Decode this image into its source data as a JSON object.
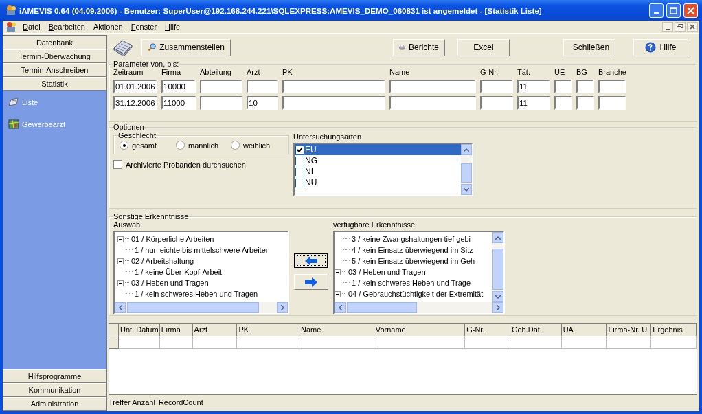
{
  "window": {
    "title": "iAMEVIS 0.64 (04.09.2006) - Benutzer: SuperUser@192.168.244.221\\SQLEXPRESS:AMEVIS_DEMO_060831 ist angemeldet  - [Statistik Liste]"
  },
  "menu": [
    {
      "label": "Datei",
      "mnemonic": true
    },
    {
      "label": "Bearbeiten",
      "mnemonic": true
    },
    {
      "label": "Aktionen",
      "mnemonic": false
    },
    {
      "label": "Fenster",
      "mnemonic": true
    },
    {
      "label": "Hilfe",
      "mnemonic": true
    }
  ],
  "sidebar": {
    "top_sections": [
      "Datenbank",
      "Termin-Überwachung",
      "Termin-Anschreiben",
      "Statistik"
    ],
    "items": [
      {
        "label": "Liste",
        "kind": "list"
      },
      {
        "label": "Gewerbearzt",
        "kind": "map"
      }
    ],
    "bottom_sections": [
      "Hilfsprogramme",
      "Kommunikation",
      "Administration"
    ]
  },
  "toolbar": {
    "buttons": [
      {
        "label": "Zusammenstellen",
        "kind": "search"
      },
      {
        "label": "Berichte",
        "kind": "print"
      },
      {
        "label": "Excel",
        "kind": "plain"
      },
      {
        "label": "Schließen",
        "kind": "close"
      },
      {
        "label": "Hilfe",
        "kind": "help"
      }
    ]
  },
  "parameters": {
    "title": "Parameter von, bis:",
    "columns": [
      {
        "label": "Zeitraum",
        "from": "01.01.2006",
        "to": "31.12.2006"
      },
      {
        "label": "Firma",
        "from": "10000",
        "to": "11000"
      },
      {
        "label": "Abteilung"
      },
      {
        "label": "Arzt",
        "to": "10"
      },
      {
        "label": "PK"
      },
      {
        "label": "Name"
      },
      {
        "label": "G-Nr."
      },
      {
        "label": "Tät.",
        "from": "11",
        "to": "11"
      },
      {
        "label": "UE"
      },
      {
        "label": "BG"
      },
      {
        "label": "Branche"
      }
    ]
  },
  "options": {
    "title": "Optionen",
    "gender": {
      "title": "Geschlecht",
      "choices": [
        {
          "label": "gesamt",
          "selected": true
        },
        {
          "label": "männlich",
          "selected": false
        },
        {
          "label": "weiblich",
          "selected": false
        }
      ]
    },
    "archived": {
      "label": "Archivierte Probanden durchsuchen",
      "checked": false
    },
    "exam_types": {
      "title": "Untersuchungsarten",
      "items": [
        {
          "label": "EU",
          "checked": true,
          "selected": true
        },
        {
          "label": "NG",
          "checked": false,
          "selected": false
        },
        {
          "label": "NI",
          "checked": false,
          "selected": false
        },
        {
          "label": "NU",
          "checked": false,
          "selected": false
        }
      ]
    }
  },
  "findings": {
    "title": "Sonstige Erkenntnisse",
    "selection": {
      "title": "Auswahl",
      "items": [
        {
          "label": "01 / Körperliche Arbeiten",
          "expanded": true,
          "children": [
            {
              "label": "1 / nur leichte bis mittelschwere Arbeiter"
            }
          ]
        },
        {
          "label": "02 / Arbeitshaltung",
          "expanded": true,
          "children": [
            {
              "label": "1 / keine Über-Kopf-Arbeit"
            }
          ]
        },
        {
          "label": "03 / Heben und Tragen",
          "expanded": true,
          "children": [
            {
              "label": "1 / kein schweres Heben und Tragen"
            }
          ]
        }
      ]
    },
    "available": {
      "title": "verfügbare Erkenntnisse",
      "items": [
        {
          "children": [
            {
              "label": "3 / keine Zwangshaltungen tief gebi"
            },
            {
              "label": "4 / kein Einsatz überwiegend im Sitz"
            },
            {
              "label": "5 / kein Einsatz überwiegend im Geh"
            }
          ]
        },
        {
          "label": "03 / Heben und Tragen",
          "expanded": true,
          "children": [
            {
              "label": "1 / kein schweres Heben und Trage"
            }
          ]
        },
        {
          "label": "04 / Gebrauchstüchtigkeit der Extremität",
          "expanded": true
        }
      ]
    }
  },
  "table": {
    "columns": [
      "Unt. Datum",
      "Firma",
      "Arzt",
      "PK",
      "Name",
      "Vorname",
      "G-Nr.",
      "Geb.Dat.",
      "UA",
      "Firma-Nr. U",
      "Ergebnis"
    ]
  },
  "status_bar": {
    "label": "Treffer Anzahl",
    "value": "RecordCount"
  }
}
